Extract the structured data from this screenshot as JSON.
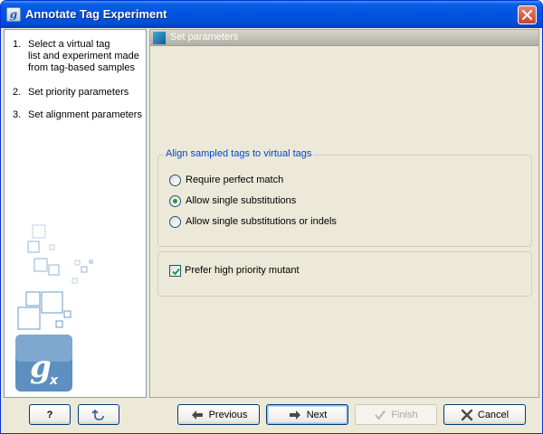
{
  "window": {
    "title": "Annotate Tag Experiment"
  },
  "steps": [
    {
      "num": "1.",
      "lines": [
        "Select a virtual tag",
        "list and experiment made",
        "from tag-based samples"
      ]
    },
    {
      "num": "2.",
      "lines": [
        "Set priority parameters"
      ]
    },
    {
      "num": "3.",
      "lines": [
        "Set alignment parameters"
      ]
    }
  ],
  "header": {
    "title": "Set parameters"
  },
  "align_group": {
    "title": "Align sampled tags to virtual tags",
    "options": [
      {
        "label": "Require perfect match",
        "selected": false
      },
      {
        "label": "Allow single substitutions",
        "selected": true
      },
      {
        "label": "Allow single substitutions or indels",
        "selected": false
      }
    ]
  },
  "priority_group": {
    "label": "Prefer high priority mutant",
    "checked": true
  },
  "buttons": {
    "help": "?",
    "previous": "Previous",
    "next": "Next",
    "finish": "Finish",
    "cancel": "Cancel"
  },
  "colors": {
    "title_bar": "#0054e3",
    "group_title": "#0046d5",
    "radio_selected": "#21a121"
  },
  "icons": [
    "app-logo-icon",
    "close-icon",
    "help-icon",
    "reset-icon",
    "arrow-left-icon",
    "arrow-right-icon",
    "checkmark-icon",
    "x-icon"
  ]
}
